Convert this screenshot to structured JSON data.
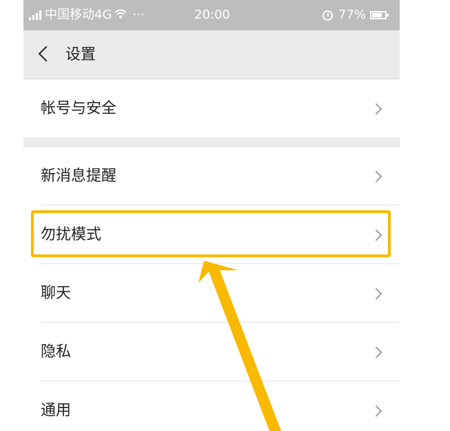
{
  "status_bar": {
    "carrier": "中国移动4G",
    "more": "···",
    "time": "20:00",
    "battery": "77%",
    "battery_level": 0.77
  },
  "nav": {
    "back_icon": "chevron-left-icon",
    "title": "设置"
  },
  "settings": {
    "account_security": "帐号与安全",
    "new_message": "新消息提醒",
    "do_not_disturb": "勿扰模式",
    "chat": "聊天",
    "privacy": "隐私",
    "general": "通用"
  },
  "annotation": {
    "color": "#f9b900"
  },
  "colors": {
    "status_bar": "#bdbdbd",
    "nav_bar": "#ebebeb",
    "chevron": "#9e9e9e"
  }
}
